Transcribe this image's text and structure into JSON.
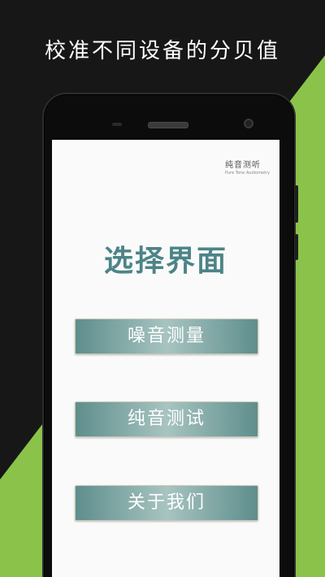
{
  "promo": {
    "headline": "校准不同设备的分贝值"
  },
  "colors": {
    "background_dark": "#171717",
    "accent_green": "#8bc34a",
    "title_teal": "#4c8487",
    "button_teal": "#5e8e8c"
  },
  "app": {
    "brand_name": "纯音测听",
    "brand_subtitle": "Pure Tone Audiometry",
    "page_title": "选择界面",
    "buttons": [
      {
        "label": "噪音测量"
      },
      {
        "label": "纯音测试"
      },
      {
        "label": "关于我们"
      }
    ]
  }
}
